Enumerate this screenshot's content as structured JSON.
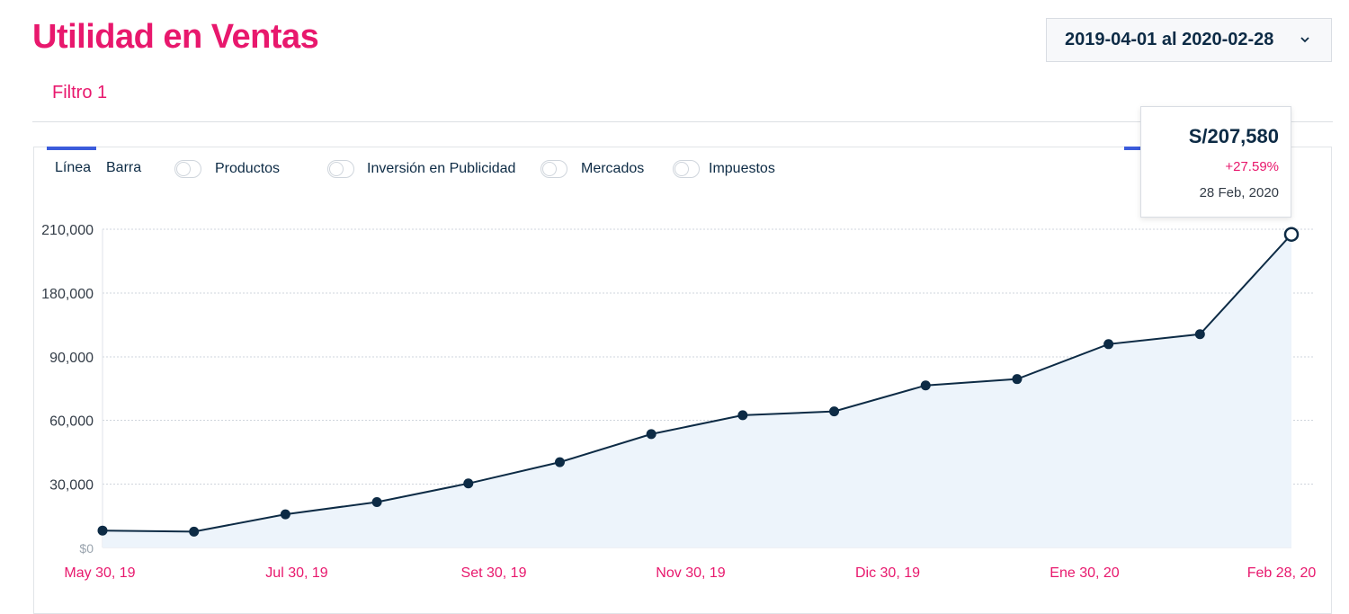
{
  "header": {
    "title": "Utilidad en Ventas"
  },
  "date_range": {
    "label": "2019-04-01 al 2020-02-28",
    "icon": "chevron-down-icon"
  },
  "filter": {
    "label": "Filtro 1"
  },
  "chart_tabs": [
    {
      "label": "Línea"
    },
    {
      "label": "Barra"
    }
  ],
  "toggles": [
    {
      "label": "Productos"
    },
    {
      "label": "Inversión en Publicidad"
    },
    {
      "label": "Mercados"
    },
    {
      "label": "Impuestos"
    }
  ],
  "tooltip": {
    "value": "S/207,580",
    "change": "+27.59%",
    "date": "28 Feb, 2020"
  },
  "colors": {
    "accent": "#e8186d",
    "line": "#0d2b45",
    "area_fill": "#edf4fb",
    "tab_indicator": "#3b5bdb",
    "grid": "#cfd5dc"
  },
  "chart_data": {
    "type": "area",
    "title": "",
    "xlabel": "",
    "ylabel": "",
    "y_ticks": [
      "$0",
      "30,000",
      "60,000",
      "90,000",
      "180,000",
      "210,000"
    ],
    "x_ticks": [
      "May 30, 19",
      "Jul 30, 19",
      "Set 30, 19",
      "Nov 30, 19",
      "Dic 30, 19",
      "Ene 30, 20",
      "Feb 28, 20"
    ],
    "grid": true,
    "series": [
      {
        "values": [
          8000,
          7500,
          15700,
          21500,
          30300,
          40300,
          53500,
          62400,
          64200,
          76500,
          79500,
          108000,
          122000,
          207580
        ]
      }
    ],
    "highlight": {
      "index": 13,
      "value": 207580
    }
  }
}
